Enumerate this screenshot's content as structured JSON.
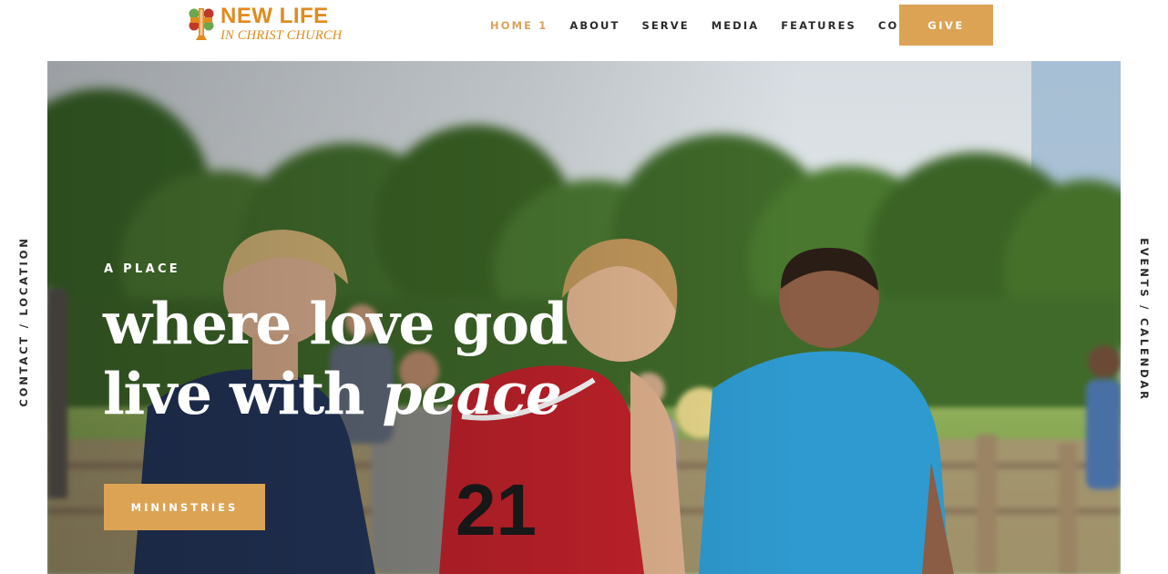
{
  "brand": {
    "name": "NEW LIFE",
    "tagline": "IN CHRIST CHURCH",
    "color": "#e08a1e"
  },
  "nav": {
    "items": [
      {
        "label": "HOME 1",
        "active": true
      },
      {
        "label": "ABOUT",
        "active": false
      },
      {
        "label": "SERVE",
        "active": false
      },
      {
        "label": "MEDIA",
        "active": false
      },
      {
        "label": "FEATURES",
        "active": false
      },
      {
        "label": "CONTACTS",
        "active": false
      }
    ],
    "active_color": "#d9a35a",
    "give_label": "GIVE"
  },
  "hero": {
    "kicker": "A PLACE",
    "line1": "where love god",
    "line2_prefix": "live with",
    "line2_accent": "peace",
    "cta_label": "MININSTRIES",
    "accent_color": "#dca354"
  },
  "side": {
    "left": "CONTACT / LOCATION",
    "right": "EVENTS / CALENDAR"
  }
}
